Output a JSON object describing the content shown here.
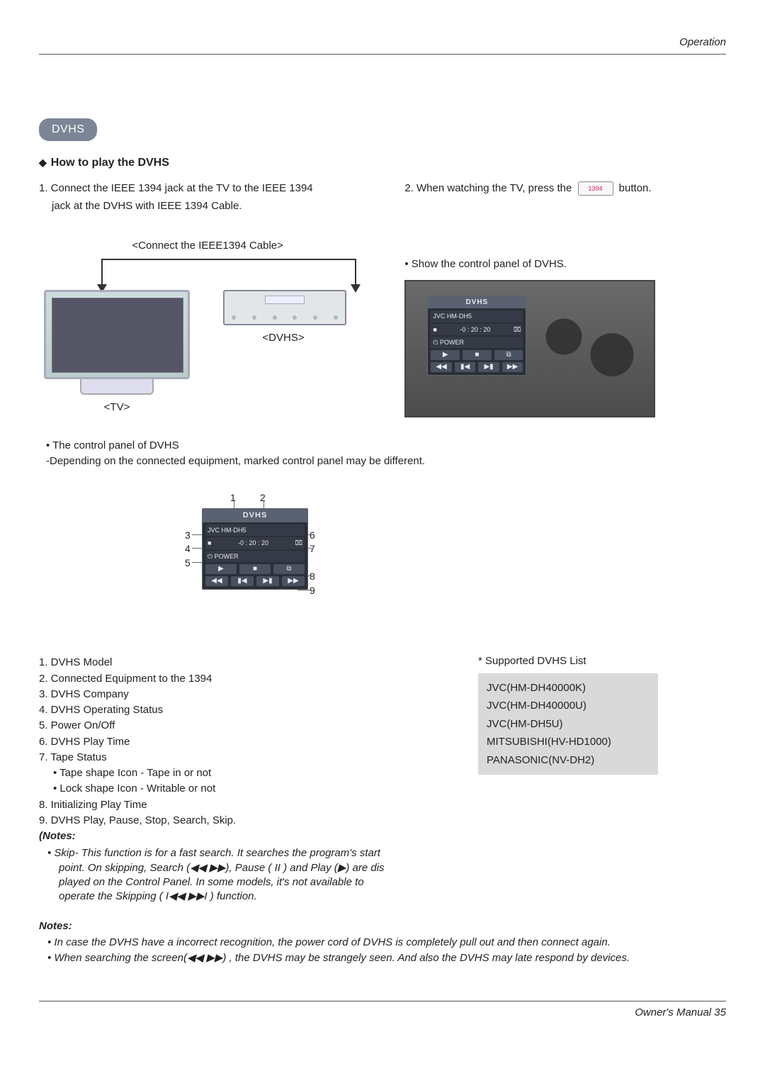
{
  "header": {
    "section": "Operation"
  },
  "badge": "DVHS",
  "heading": "How to play the DVHS",
  "steps": {
    "s1a": "1. Connect the IEEE 1394 jack at the TV to the IEEE 1394",
    "s1b": "jack at the DVHS with IEEE 1394 Cable.",
    "s2a": "2. When watching the TV,  press the",
    "s2b": "button.",
    "btn1394": "1394"
  },
  "diagram": {
    "cable_title": "<Connect the IEEE1394 Cable>",
    "tv_label": "<TV>",
    "dvhs_label": "<DVHS>"
  },
  "right_note": "• Show the control panel of DVHS.",
  "panel": {
    "title": "DVHS",
    "line1": "JVC HM-DH5",
    "stop_glyph": "■",
    "time": "-0 : 20 : 20",
    "tape_icon": "⌧",
    "power": "⏻ POWER",
    "play": "▶",
    "stop": "■",
    "idx": "⧉",
    "rew": "◀◀",
    "prev": "▮◀",
    "next": "▶▮",
    "fwd": "▶▶"
  },
  "control_note": {
    "l1": "• The control panel of DVHS",
    "l2": "-Depending on the connected equipment, marked control panel may be different."
  },
  "legend_nums": {
    "n1": "1",
    "n2": "2",
    "n3": "3",
    "n4": "4",
    "n5": "5",
    "n6": "6",
    "n7": "7",
    "n8": "8",
    "n9": "9"
  },
  "leftlist": {
    "i1": "1. DVHS Model",
    "i2": "2. Connected Equipment to the 1394",
    "i3": "3. DVHS Company",
    "i4": "4. DVHS Operating Status",
    "i5": "5. Power On/Off",
    "i6": "6. DVHS Play Time",
    "i7": "7. Tape Status",
    "i7a": "• Tape shape Icon - Tape in or not",
    "i7b": "• Lock shape Icon - Writable or not",
    "i8": "8. Initializing Play Time",
    "i9": "9. DVHS Play, Pause, Stop, Search, Skip.",
    "notes_label": "(Notes:",
    "note_skip1": "• Skip-   This function is for a fast search. It searches the program's start",
    "note_skip2": "point. On skipping, Search (◀◀ ▶▶), Pause ( II ) and Play (▶) are dis",
    "note_skip3": "played on the Control Panel. In some models, it's not available to",
    "note_skip4": "operate  the Skipping ( I◀◀ ▶▶I ) function."
  },
  "rightlist": {
    "hdr": "* Supported DVHS List",
    "models": [
      "JVC(HM-DH40000K)",
      "JVC(HM-DH40000U)",
      "JVC(HM-DH5U)",
      "MITSUBISHI(HV-HD1000)",
      "PANASONIC(NV-DH2)"
    ]
  },
  "bottom_notes": {
    "title": "Notes:",
    "b1": "• In case the DVHS have a incorrect recognition, the power cord of DVHS is completely pull out and then connect again.",
    "b2": "• When searching the screen(◀◀ ▶▶) , the DVHS may be strangely seen. And also the DVHS may late respond by devices."
  },
  "footer": "Owner's Manual   35"
}
